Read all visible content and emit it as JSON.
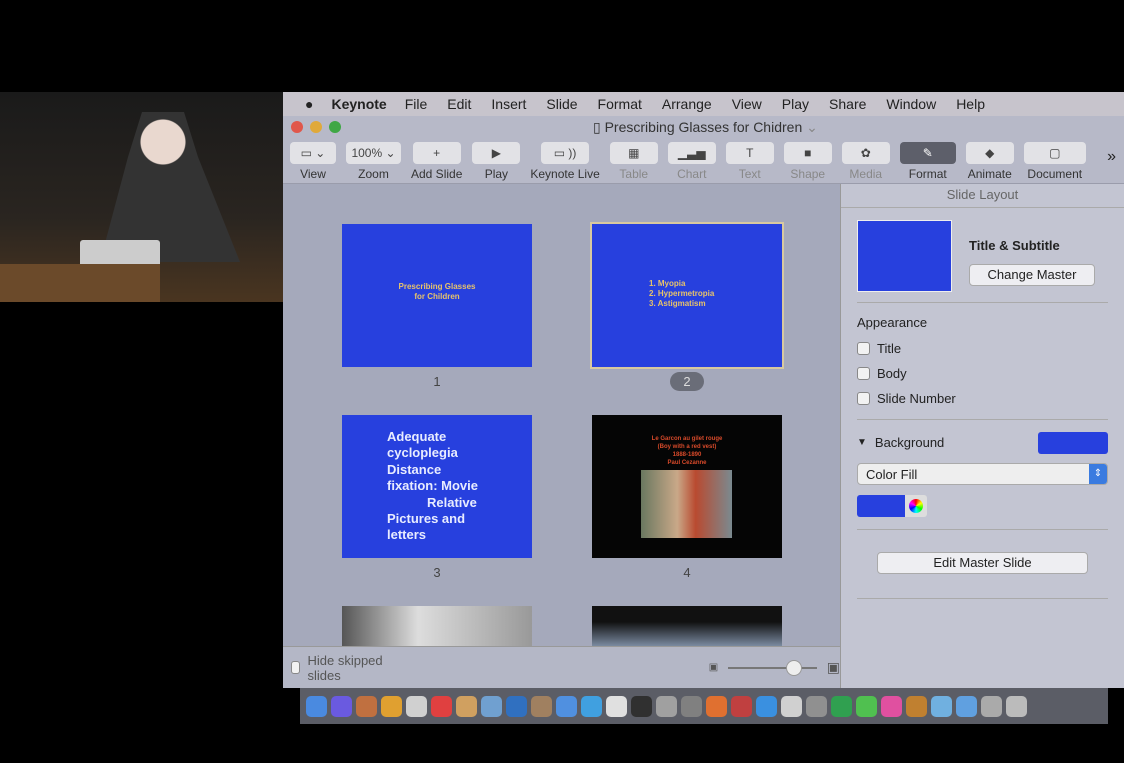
{
  "menubar": {
    "app": "Keynote",
    "items": [
      "File",
      "Edit",
      "Insert",
      "Slide",
      "Format",
      "Arrange",
      "View",
      "Play",
      "Share",
      "Window",
      "Help"
    ]
  },
  "window": {
    "title": "Prescribing Glasses for Chidren"
  },
  "toolbar": {
    "items": [
      {
        "label": "View",
        "icon": "▭ ⌄",
        "w": 46
      },
      {
        "label": "Zoom",
        "icon": "100% ⌄",
        "w": 55
      },
      {
        "label": "Add Slide",
        "icon": "+",
        "w": 48
      },
      {
        "label": "Play",
        "icon": "▶",
        "w": 48
      },
      {
        "label": "Keynote Live",
        "icon": "▭ ))",
        "w": 48
      },
      {
        "label": "Table",
        "icon": "▦",
        "w": 48,
        "dim": true
      },
      {
        "label": "Chart",
        "icon": "▁▃▅",
        "w": 48,
        "dim": true
      },
      {
        "label": "Text",
        "icon": "T",
        "w": 48,
        "dim": true
      },
      {
        "label": "Shape",
        "icon": "■",
        "w": 48,
        "dim": true
      },
      {
        "label": "Media",
        "icon": "✿",
        "w": 48,
        "dim": true
      },
      {
        "label": "Format",
        "icon": "✎",
        "w": 56,
        "sel": true
      },
      {
        "label": "Animate",
        "icon": "◆",
        "w": 48
      },
      {
        "label": "Document",
        "icon": "▢",
        "w": 62
      }
    ],
    "overflow": "»"
  },
  "slides": [
    {
      "num": "1",
      "lines": [
        "Prescribing Glasses",
        "for Children"
      ]
    },
    {
      "num": "2",
      "lines": [
        "1. Myopia",
        "2. Hypermetropia",
        "3. Astigmatism"
      ],
      "selected": true
    },
    {
      "num": "3",
      "lines": [
        "Adequate",
        "cycloplegia",
        "Distance",
        "fixation: Movie",
        "Relative",
        "Pictures and",
        "letters"
      ]
    },
    {
      "num": "4",
      "lines": [
        "Le Garcon au gilet rouge",
        "(Boy with a red vest)",
        "1888-1890",
        "Paul Cezanne"
      ]
    }
  ],
  "bottombar": {
    "hide_skipped": "Hide skipped slides"
  },
  "panel": {
    "header": "Slide Layout",
    "master_name": "Title & Subtitle",
    "change_master": "Change Master",
    "appearance": "Appearance",
    "checks": [
      "Title",
      "Body",
      "Slide Number"
    ],
    "background": "Background",
    "fill": "Color Fill",
    "edit_master": "Edit Master Slide"
  },
  "colors": {
    "slide_blue": "#2740de",
    "slide_text": "#e7c36a"
  }
}
